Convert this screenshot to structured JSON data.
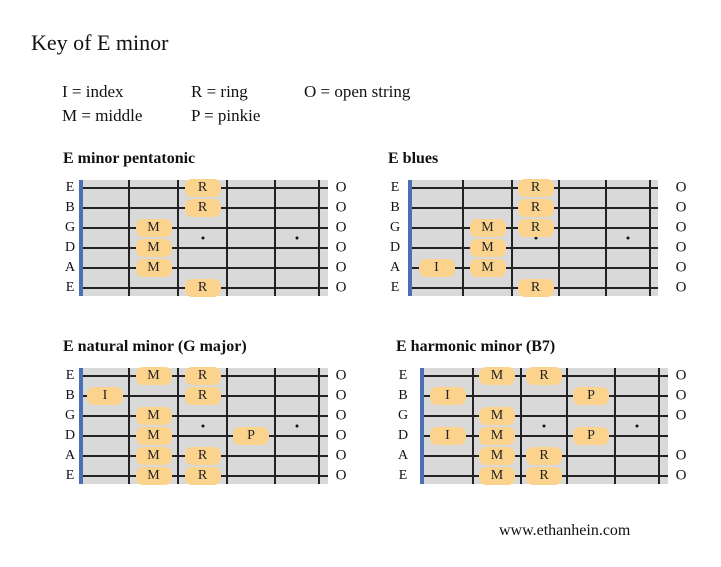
{
  "title": "Key of E minor",
  "legend": [
    {
      "label": "I = index"
    },
    {
      "label": "R = ring"
    },
    {
      "label": "O = open string"
    },
    {
      "label": "M = middle"
    },
    {
      "label": "P = pinkie"
    }
  ],
  "strings": [
    "E",
    "B",
    "G",
    "D",
    "A",
    "E"
  ],
  "open_symbol": "O",
  "colors": {
    "note": "#fcd38d",
    "nut": "#4a6fb5",
    "fretboard": "#d9d9d9"
  },
  "diagrams": [
    {
      "title": "E minor pentatonic",
      "open_strings": [
        true,
        true,
        true,
        true,
        true,
        true
      ],
      "notes": [
        {
          "string": 0,
          "fret": 3,
          "finger": "R"
        },
        {
          "string": 1,
          "fret": 3,
          "finger": "R"
        },
        {
          "string": 2,
          "fret": 2,
          "finger": "M"
        },
        {
          "string": 3,
          "fret": 2,
          "finger": "M"
        },
        {
          "string": 4,
          "fret": 2,
          "finger": "M"
        },
        {
          "string": 5,
          "fret": 3,
          "finger": "R"
        }
      ]
    },
    {
      "title": "E blues",
      "open_strings": [
        true,
        true,
        true,
        true,
        true,
        true
      ],
      "notes": [
        {
          "string": 0,
          "fret": 3,
          "finger": "R"
        },
        {
          "string": 1,
          "fret": 3,
          "finger": "R"
        },
        {
          "string": 2,
          "fret": 2,
          "finger": "M"
        },
        {
          "string": 2,
          "fret": 3,
          "finger": "R"
        },
        {
          "string": 3,
          "fret": 2,
          "finger": "M"
        },
        {
          "string": 4,
          "fret": 1,
          "finger": "I"
        },
        {
          "string": 4,
          "fret": 2,
          "finger": "M"
        },
        {
          "string": 5,
          "fret": 3,
          "finger": "R"
        }
      ]
    },
    {
      "title": "E natural minor (G major)",
      "open_strings": [
        true,
        true,
        true,
        true,
        true,
        true
      ],
      "notes": [
        {
          "string": 0,
          "fret": 2,
          "finger": "M"
        },
        {
          "string": 0,
          "fret": 3,
          "finger": "R"
        },
        {
          "string": 1,
          "fret": 1,
          "finger": "I"
        },
        {
          "string": 1,
          "fret": 3,
          "finger": "R"
        },
        {
          "string": 2,
          "fret": 2,
          "finger": "M"
        },
        {
          "string": 3,
          "fret": 2,
          "finger": "M"
        },
        {
          "string": 3,
          "fret": 4,
          "finger": "P"
        },
        {
          "string": 4,
          "fret": 2,
          "finger": "M"
        },
        {
          "string": 4,
          "fret": 3,
          "finger": "R"
        },
        {
          "string": 5,
          "fret": 2,
          "finger": "M"
        },
        {
          "string": 5,
          "fret": 3,
          "finger": "R"
        }
      ]
    },
    {
      "title": "E harmonic minor (B7)",
      "open_strings": [
        true,
        true,
        true,
        false,
        true,
        true
      ],
      "notes": [
        {
          "string": 0,
          "fret": 2,
          "finger": "M"
        },
        {
          "string": 0,
          "fret": 3,
          "finger": "R"
        },
        {
          "string": 1,
          "fret": 1,
          "finger": "I"
        },
        {
          "string": 1,
          "fret": 4,
          "finger": "P"
        },
        {
          "string": 2,
          "fret": 2,
          "finger": "M"
        },
        {
          "string": 3,
          "fret": 1,
          "finger": "I"
        },
        {
          "string": 3,
          "fret": 2,
          "finger": "M"
        },
        {
          "string": 3,
          "fret": 4,
          "finger": "P"
        },
        {
          "string": 4,
          "fret": 2,
          "finger": "M"
        },
        {
          "string": 4,
          "fret": 3,
          "finger": "R"
        },
        {
          "string": 5,
          "fret": 2,
          "finger": "M"
        },
        {
          "string": 5,
          "fret": 3,
          "finger": "R"
        }
      ]
    }
  ],
  "inlay_frets": [
    3,
    5
  ],
  "footer": "www.ethanhein.com"
}
